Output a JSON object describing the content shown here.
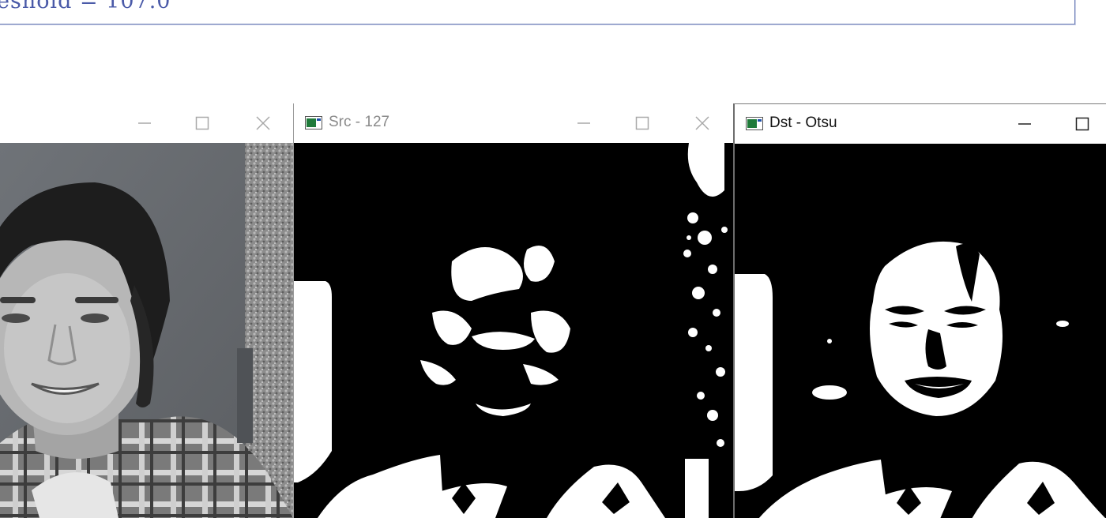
{
  "console": {
    "text": "eshold = 107.0"
  },
  "windows": [
    {
      "title": ""
    },
    {
      "title": "Src - 127"
    },
    {
      "title": "Dst - Otsu"
    }
  ],
  "icons": {
    "app": "opencv-window-icon",
    "minimize": "minimize-icon",
    "maximize": "maximize-icon",
    "close": "close-icon"
  },
  "colors": {
    "console_text": "#4a5aa8",
    "binary_fg": "#ffffff",
    "binary_bg": "#000000"
  }
}
